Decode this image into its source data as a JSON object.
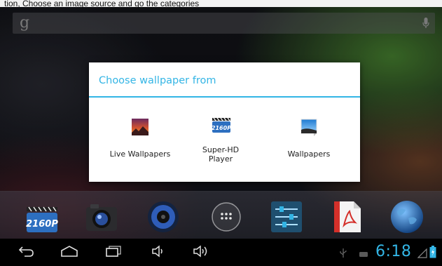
{
  "top_fragment": "tion, Choose an image source and go the categories",
  "dialog": {
    "title": "Choose wallpaper from",
    "options": [
      {
        "label": "Live Wallpapers",
        "icon": "live-wallpapers-icon"
      },
      {
        "label": "Super-HD\nPlayer",
        "icon": "super-hd-player-icon"
      },
      {
        "label": "Wallpapers",
        "icon": "wallpapers-gallery-icon"
      }
    ]
  },
  "dock": {
    "apps": [
      "super-hd-player-icon",
      "camera-icon",
      "music-icon",
      "all-apps-icon",
      "settings-icon",
      "pdf-reader-icon",
      "browser-globe-icon"
    ]
  },
  "status": {
    "time": "6:18"
  },
  "colors": {
    "accent": "#33b5e5",
    "dialog_bg": "#ffffff",
    "navbar_bg": "#000000"
  }
}
